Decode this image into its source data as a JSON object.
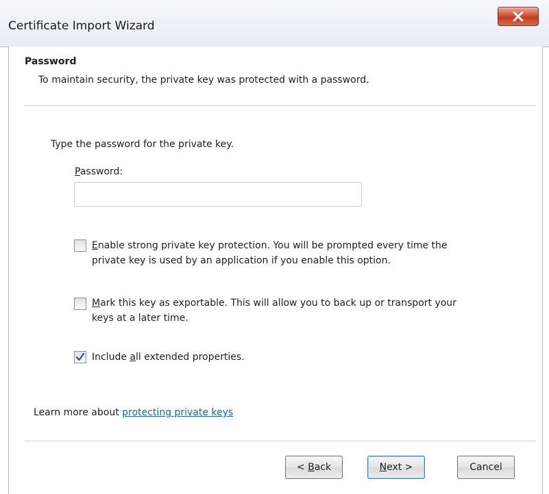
{
  "window": {
    "title": "Certificate Import Wizard"
  },
  "header": {
    "title": "Password",
    "subtitle": "To maintain security, the private key was protected with a password."
  },
  "body": {
    "prompt": "Type the password for the private key.",
    "password_label_mnemonic": "P",
    "password_label_rest": "assword:",
    "password_value": ""
  },
  "options": [
    {
      "checked": false,
      "line1_mnemonic": "E",
      "line1_rest": "nable strong private key protection. You will be prompted every time the",
      "line2": "private key is used by an application if you enable this option."
    },
    {
      "checked": false,
      "line1_mnemonic": "M",
      "line1_rest": "ark this key as exportable. This will allow you to back up or transport your",
      "line2": "keys at a later time."
    },
    {
      "checked": true,
      "pre": "Include ",
      "mnemonic": "a",
      "post": "ll extended properties."
    }
  ],
  "learn_more": {
    "text": "Learn more about ",
    "link": "protecting private keys"
  },
  "buttons": {
    "back_prefix": "< ",
    "back_mnemonic": "B",
    "back_rest": "ack",
    "next_mnemonic": "N",
    "next_rest": "ext >",
    "cancel": "Cancel"
  },
  "colors": {
    "link": "#1565c0",
    "close_button": "#c94a31",
    "check_mark": "#2a4f9c"
  },
  "icons": {
    "close": "close-x-icon",
    "check": "checkmark-icon"
  }
}
